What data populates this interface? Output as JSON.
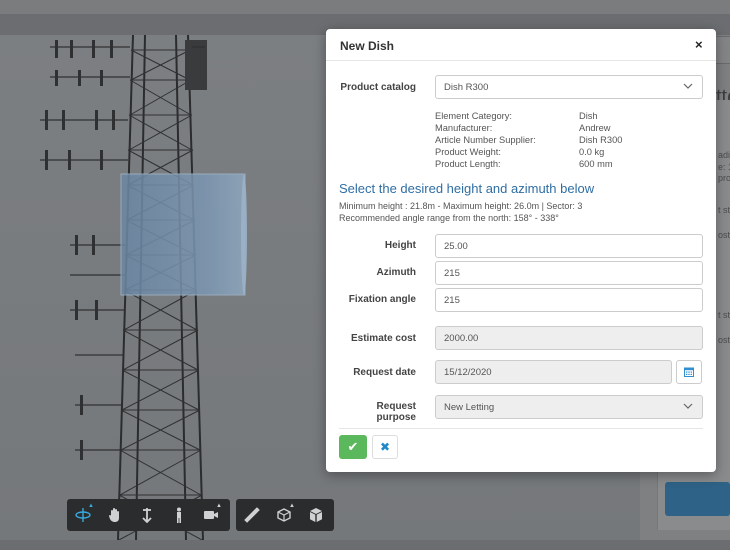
{
  "modal": {
    "title": "New Dish",
    "close_icon": "×",
    "product_catalog": {
      "label": "Product catalog",
      "value": "Dish R300"
    },
    "details": [
      {
        "key": "Element Category:",
        "value": "Dish"
      },
      {
        "key": "Manufacturer:",
        "value": "Andrew"
      },
      {
        "key": "Article Number Supplier:",
        "value": "Dish R300"
      },
      {
        "key": "Product Weight:",
        "value": "0.0 kg"
      },
      {
        "key": "Product Length:",
        "value": "600 mm"
      }
    ],
    "section_title": "Select the desired height and azimuth below",
    "section_line1": "Minimum height : 21.8m - Maximum height: 26.0m | Sector: 3",
    "section_line2": "Recommended angle range from the north: 158° - 338°",
    "height": {
      "label": "Height",
      "value": "25.00"
    },
    "azimuth": {
      "label": "Azimuth",
      "value": "215"
    },
    "fixation_angle": {
      "label": "Fixation angle",
      "value": "215"
    },
    "estimate_cost": {
      "label": "Estimate cost",
      "value": "2000.00"
    },
    "request_date": {
      "label": "Request date",
      "value": "15/12/2020"
    },
    "request_purpose": {
      "label": "Request purpose",
      "value": "New Letting"
    },
    "ok_icon": "✔",
    "cancel_icon": "✖"
  },
  "background_panel": {
    "title_partial": "tte",
    "lines": [
      "adi",
      "e: 1",
      "pro",
      "t st",
      "ost",
      "t st",
      "ost"
    ]
  },
  "toolbar_icons": [
    "orbit-icon",
    "pan-hand-icon",
    "move-vertical-icon",
    "walk-person-icon",
    "camera-icon",
    "measure-ruler-icon",
    "section-box-icon",
    "cube-icon"
  ],
  "colors": {
    "accent": "#2f6ea3",
    "ok": "#5cb85c",
    "active_tool": "#39a8dd"
  }
}
